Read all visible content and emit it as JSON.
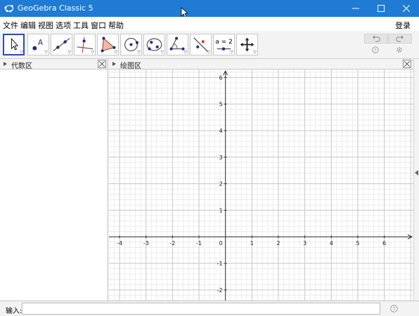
{
  "window": {
    "title": "GeoGebra Classic 5",
    "colors": {
      "titlebar": "#1f7bd3",
      "selected_tool": "#2a4cb5",
      "point": "#1c2f8a",
      "accent_red": "#d23c3c"
    }
  },
  "menu": {
    "items": [
      "文件",
      "编辑",
      "视图",
      "选项",
      "工具",
      "窗口",
      "帮助"
    ],
    "login": "登录"
  },
  "toolbar": {
    "tools": [
      {
        "name": "move-tool",
        "icon": "arrow-icon"
      },
      {
        "name": "point-tool",
        "icon": "point-a-icon",
        "label": "A"
      },
      {
        "name": "line-tool",
        "icon": "line-icon"
      },
      {
        "name": "perpendicular-tool",
        "icon": "perpendicular-icon"
      },
      {
        "name": "polygon-tool",
        "icon": "triangle-icon"
      },
      {
        "name": "circle-tool",
        "icon": "circle-icon"
      },
      {
        "name": "conic-tool",
        "icon": "ellipse-icon"
      },
      {
        "name": "angle-tool",
        "icon": "angle-icon"
      },
      {
        "name": "reflect-tool",
        "icon": "reflect-icon"
      },
      {
        "name": "slider-tool",
        "icon": "slider-icon",
        "label": "a = 2"
      },
      {
        "name": "move-view-tool",
        "icon": "move-view-icon"
      }
    ],
    "undo": "undo-icon",
    "redo": "redo-icon",
    "help": "help-icon",
    "settings": "gear-icon"
  },
  "algebra": {
    "title": "代数区"
  },
  "graphics": {
    "title": "绘图区",
    "x_ticks": [
      "-4",
      "-3",
      "-2",
      "-1",
      "0",
      "1",
      "2",
      "3",
      "4",
      "5",
      "6"
    ],
    "y_ticks": [
      "6",
      "5",
      "4",
      "3",
      "2",
      "1",
      "-1",
      "-2"
    ],
    "xlim": [
      -4.4,
      7.1
    ],
    "ylim": [
      -2.4,
      6.3
    ],
    "grid": true
  },
  "input": {
    "label": "输入:",
    "value": "",
    "placeholder": ""
  }
}
